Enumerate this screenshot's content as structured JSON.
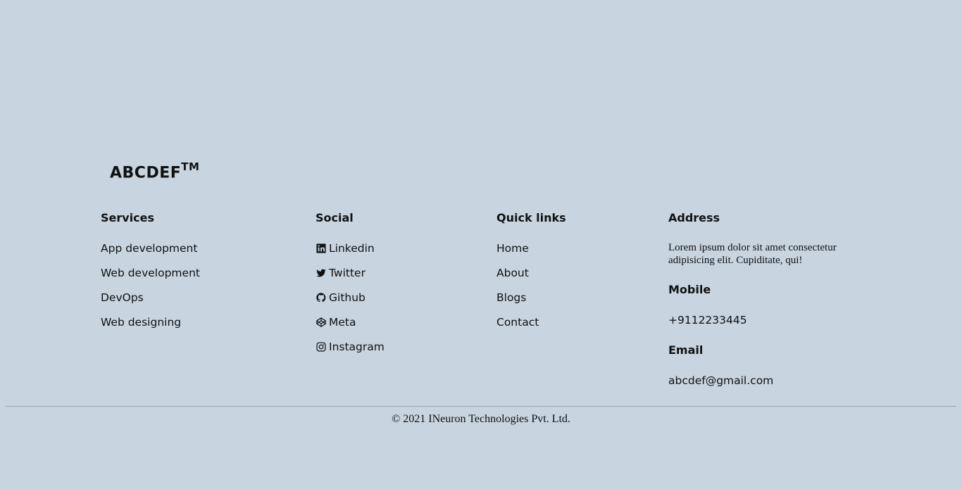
{
  "brand": {
    "name": "ABCDEF",
    "mark": "TM"
  },
  "services": {
    "heading": "Services",
    "items": [
      {
        "label": "App development"
      },
      {
        "label": "Web development"
      },
      {
        "label": "DevOps"
      },
      {
        "label": "Web designing"
      }
    ]
  },
  "social": {
    "heading": "Social",
    "items": [
      {
        "label": "Linkedin",
        "icon": "linkedin-icon"
      },
      {
        "label": "Twitter",
        "icon": "twitter-icon"
      },
      {
        "label": "Github",
        "icon": "github-icon"
      },
      {
        "label": "Meta",
        "icon": "codepen-icon"
      },
      {
        "label": "Instagram",
        "icon": "instagram-icon"
      }
    ]
  },
  "quick_links": {
    "heading": "Quick links",
    "items": [
      {
        "label": "Home"
      },
      {
        "label": "About"
      },
      {
        "label": "Blogs"
      },
      {
        "label": "Contact"
      }
    ]
  },
  "address": {
    "heading": "Address",
    "text": "Lorem ipsum dolor sit amet consectetur adipisicing elit. Cupiditate, qui!",
    "mobile_heading": "Mobile",
    "mobile": "+9112233445",
    "email_heading": "Email",
    "email": "abcdef@gmail.com"
  },
  "copyright": "© 2021 INeuron Technologies Pvt. Ltd.",
  "colors": {
    "background": "#c8d4e0",
    "text": "#111111"
  }
}
